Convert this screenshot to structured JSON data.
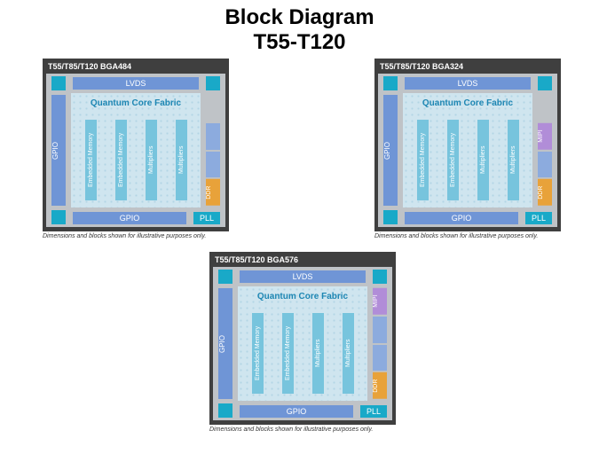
{
  "title_line1": "Block Diagram",
  "title_line2": "T55-T120",
  "labels": {
    "lvds": "LVDS",
    "gpio": "GPIO",
    "pll": "PLL",
    "mipi": "MIPI",
    "ddr": "DDR",
    "fabric": "Quantum Core Fabric",
    "col_mem": "Embedded Memory",
    "col_mult": "Multipliers"
  },
  "footnote": "Dimensions and blocks shown for illustrative purposes only.",
  "cards": {
    "bga484": {
      "title": "T55/T85/T120 BGA484"
    },
    "bga324": {
      "title": "T55/T85/T120 BGA324"
    },
    "bga576": {
      "title": "T55/T85/T120 BGA576"
    }
  }
}
